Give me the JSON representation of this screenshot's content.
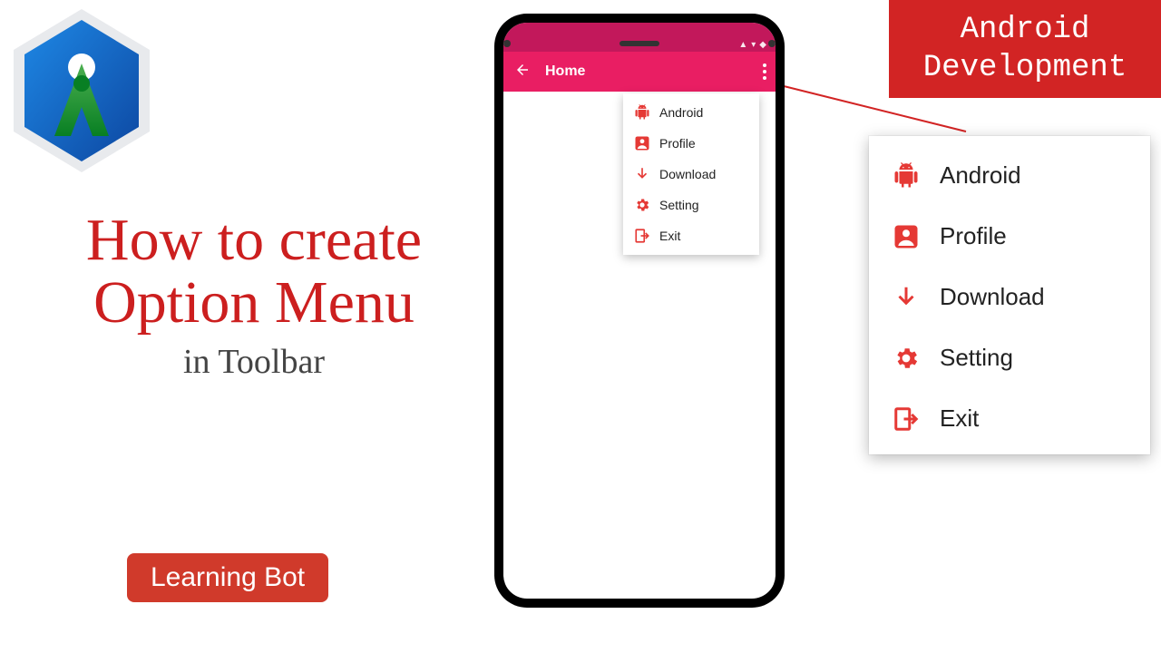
{
  "logo_name": "android-studio-logo",
  "title": {
    "line1": "How to create",
    "line2": "Option Menu",
    "sub": "in Toolbar"
  },
  "chip_label": "Learning Bot",
  "banner": {
    "line1": "Android",
    "line2": "Development"
  },
  "phone": {
    "toolbar_title": "Home"
  },
  "menu": {
    "items": [
      {
        "icon": "android-icon",
        "label": "Android"
      },
      {
        "icon": "profile-icon",
        "label": "Profile"
      },
      {
        "icon": "download-icon",
        "label": "Download"
      },
      {
        "icon": "setting-icon",
        "label": "Setting"
      },
      {
        "icon": "exit-icon",
        "label": "Exit"
      }
    ]
  },
  "colors": {
    "accent_red": "#d22424",
    "toolbar_pink": "#e91e63",
    "status_pink": "#c2185b"
  }
}
